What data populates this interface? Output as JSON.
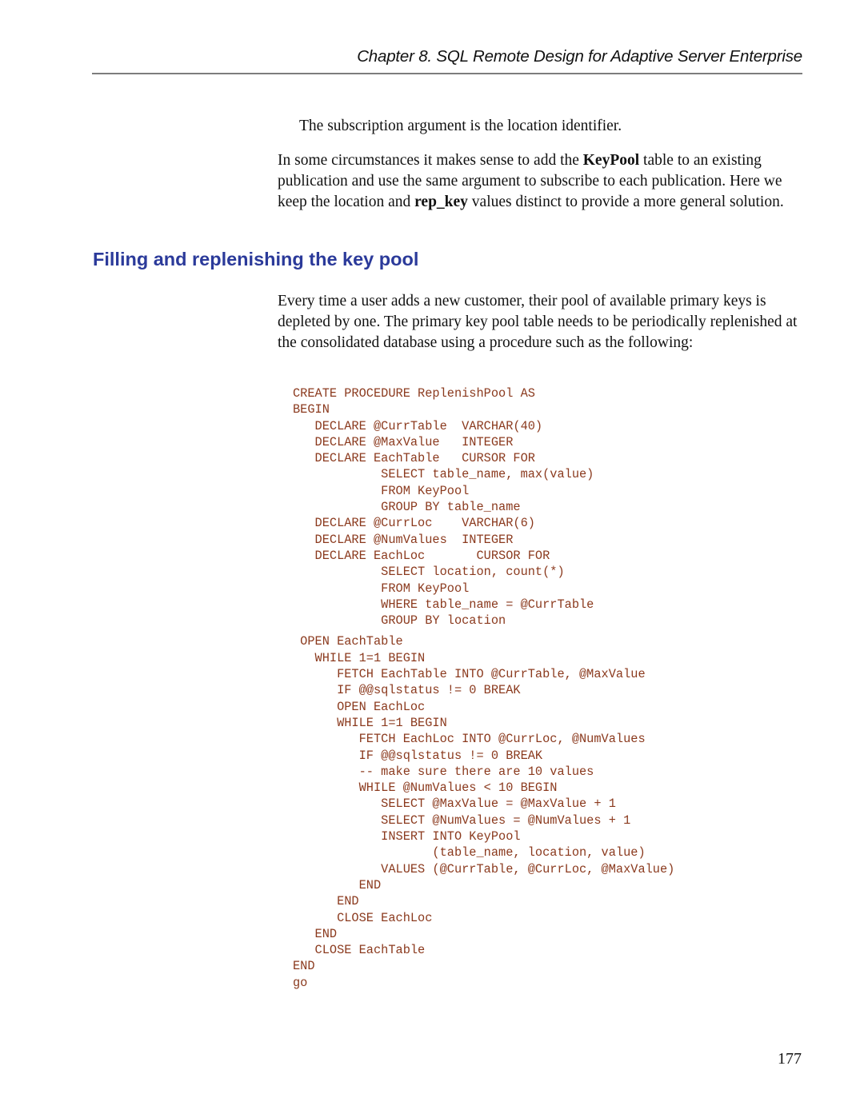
{
  "header": {
    "running_title": "Chapter 8.  SQL Remote Design for Adaptive Server Enterprise"
  },
  "intro": {
    "para1": "The subscription argument is the location identifier.",
    "para2": {
      "text1": "In some circumstances it makes sense to add the ",
      "bold1": "KeyPool",
      "text2": " table to an existing publication and use the same argument to subscribe to each publication. Here we keep the location and ",
      "bold2": "rep_key",
      "text3": " values distinct to provide a more general solution."
    }
  },
  "section": {
    "heading": "Filling and replenishing the key pool",
    "body": "Every time a user adds a new customer, their pool of available primary keys is depleted by one. The primary key pool table needs to be periodically replenished at the consolidated database using a procedure such as the following:"
  },
  "code_lines": [
    "CREATE PROCEDURE ReplenishPool AS",
    "BEGIN",
    "   DECLARE @CurrTable  VARCHAR(40)",
    "   DECLARE @MaxValue   INTEGER",
    "   DECLARE EachTable   CURSOR FOR",
    "            SELECT table_name, max(value)",
    "            FROM KeyPool",
    "            GROUP BY table_name",
    "   DECLARE @CurrLoc    VARCHAR(6)",
    "   DECLARE @NumValues  INTEGER",
    "   DECLARE EachLoc       CURSOR FOR",
    "            SELECT location, count(*)",
    "            FROM KeyPool",
    "            WHERE table_name = @CurrTable",
    "            GROUP BY location",
    " OPEN EachTable",
    "   WHILE 1=1 BEGIN",
    "      FETCH EachTable INTO @CurrTable, @MaxValue",
    "      IF @@sqlstatus != 0 BREAK",
    "      OPEN EachLoc",
    "      WHILE 1=1 BEGIN",
    "         FETCH EachLoc INTO @CurrLoc, @NumValues",
    "         IF @@sqlstatus != 0 BREAK",
    "         -- make sure there are 10 values",
    "         WHILE @NumValues < 10 BEGIN",
    "            SELECT @MaxValue = @MaxValue + 1",
    "            SELECT @NumValues = @NumValues + 1",
    "            INSERT INTO KeyPool",
    "                   (table_name, location, value)",
    "            VALUES (@CurrTable, @CurrLoc, @MaxValue)",
    "         END",
    "      END",
    "      CLOSE EachLoc",
    "   END",
    "   CLOSE EachTable",
    "END",
    "go"
  ],
  "footer": {
    "page_number": "177"
  }
}
